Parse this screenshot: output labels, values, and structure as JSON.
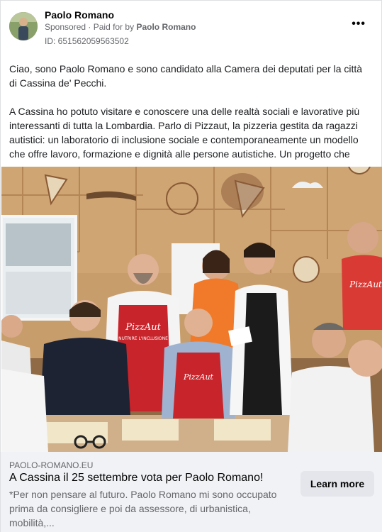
{
  "post": {
    "author": "Paolo Romano",
    "sponsored": "Sponsored",
    "paid_prefix": "· Paid for by",
    "paid_by": "Paolo Romano",
    "ad_id": "ID: 651562059563502",
    "more_icon": "more-horizontal-icon",
    "more_glyph": "•••"
  },
  "body": {
    "paragraph1": "Ciao, sono Paolo Romano e sono candidato alla Camera dei deputati per la città di Cassina de' Pecchi.",
    "paragraph2": "A Cassina ho potuto visitare e conoscere una delle realtà sociali e lavorative più interessanti di tutta la Lombardia. Parlo di Pizzaut, la pizzeria gestita da ragazzi autistici: un laboratorio di inclusione sociale e contemporaneamente un modello che offre lavoro, formazione e dignità alle persone autistiche. Un progetto che avr..."
  },
  "image": {
    "apron_text": "PizzAut",
    "apron_subtext": "NUTRIRE L'INCLUSIONE",
    "apron_text_2": "PizzAut",
    "apron_text_3": "PizzAut"
  },
  "link": {
    "domain": "PAOLO-ROMANO.EU",
    "headline": "A Cassina il 25 settembre vota per Paolo Romano!",
    "description": "*Per non pensare al futuro. Paolo Romano mi sono occupato prima da consigliere e poi da assessore, di urbanistica, mobilità,...",
    "cta": "Learn more"
  },
  "colors": {
    "apron_red": "#c8242b",
    "wood": "#c49a6c",
    "cta_bg": "#e4e6eb"
  }
}
